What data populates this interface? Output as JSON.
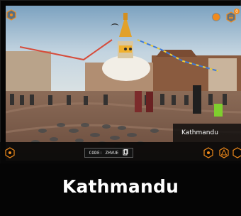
{
  "scene": {
    "location_label": "Kathmandu"
  },
  "controls": {
    "code_label": "CODE: ZHVUE",
    "notification_count": "0"
  },
  "caption": {
    "title": "Kathmandu"
  },
  "icons": {
    "top_left": "hexagon-icon",
    "menu": "hexagon-menu-icon",
    "bottom_left": "hexagon-icon",
    "bottom_right_1": "hexagon-icon",
    "bottom_right_2": "triangle-hex-icon",
    "bottom_right_3": "hexagon-icon",
    "copy": "copy-icon"
  },
  "colors": {
    "accent": "#f08a1c",
    "panel": "#0f0f0f",
    "text": "#ffffff"
  }
}
